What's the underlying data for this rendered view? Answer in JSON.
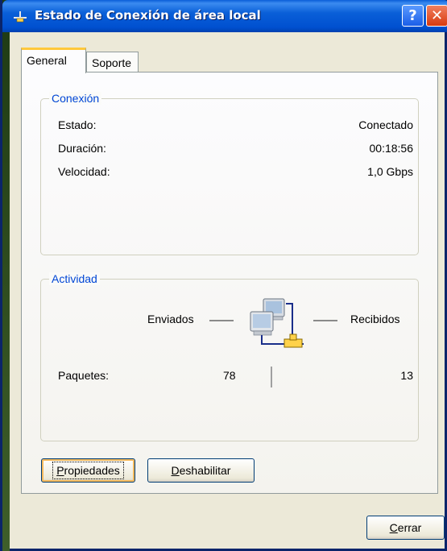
{
  "window": {
    "title": "Estado de Conexión de área local",
    "help_label": "?",
    "close_label": "✕"
  },
  "tabs": [
    {
      "label": "General",
      "active": true
    },
    {
      "label": "Soporte",
      "active": false
    }
  ],
  "connection": {
    "group_title": "Conexión",
    "rows": [
      {
        "label": "Estado:",
        "value": "Conectado"
      },
      {
        "label": "Duración:",
        "value": "00:18:56"
      },
      {
        "label": "Velocidad:",
        "value": "1,0 Gbps"
      }
    ]
  },
  "activity": {
    "group_title": "Actividad",
    "sent_label": "Enviados",
    "received_label": "Recibidos",
    "packets_label": "Paquetes:",
    "packets_sent": "78",
    "packets_received": "13"
  },
  "buttons": {
    "properties": {
      "mnemonic": "P",
      "rest": "ropiedades"
    },
    "disable": {
      "mnemonic": "D",
      "rest": "eshabilitar"
    },
    "close": {
      "mnemonic": "C",
      "rest": "errar"
    }
  },
  "colors": {
    "title_bar": "#0a5fd8",
    "group_title": "#0046d5",
    "tab_highlight": "#ffc83c",
    "close_button": "#d83a10"
  }
}
